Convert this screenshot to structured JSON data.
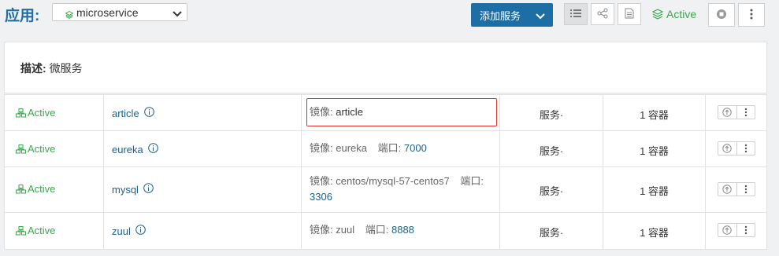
{
  "header": {
    "app_label": "应用:",
    "stack_selected": "microservice",
    "add_service_label": "添加服务",
    "state": "Active"
  },
  "icons": {
    "stack": "layers-icon",
    "chevron": "chevron-down-icon",
    "view_list": "list-icon",
    "view_graph": "share-icon",
    "view_compose": "document-icon",
    "stop": "stop-icon",
    "more": "ellipsis-vertical-icon",
    "service_state": "services-icon",
    "info": "info-icon",
    "upgrade": "upgrade-icon"
  },
  "description": {
    "label": "描述:",
    "value": "微服务"
  },
  "services": [
    {
      "state": "Active",
      "name": "article",
      "image_label": "镜像:",
      "image": "article",
      "port_label": "",
      "port": "",
      "kind": "服务·",
      "scale": "1 容器",
      "highlighted": true
    },
    {
      "state": "Active",
      "name": "eureka",
      "image_label": "镜像:",
      "image": "eureka",
      "port_label": "端口:",
      "port": "7000",
      "kind": "服务·",
      "scale": "1 容器",
      "highlighted": false
    },
    {
      "state": "Active",
      "name": "mysql",
      "image_label": "镜像:",
      "image": "centos/mysql-57-centos7",
      "port_label": "端口:",
      "port": "3306",
      "kind": "服务·",
      "scale": "1 容器",
      "highlighted": false
    },
    {
      "state": "Active",
      "name": "zuul",
      "image_label": "镜像:",
      "image": "zuul",
      "port_label": "端口:",
      "port": "8888",
      "kind": "服务·",
      "scale": "1 容器",
      "highlighted": false
    }
  ],
  "colors": {
    "primary": "#1c6ea4",
    "active": "#39a84c",
    "link": "#1d5f8c",
    "highlight": "#d9322a"
  }
}
